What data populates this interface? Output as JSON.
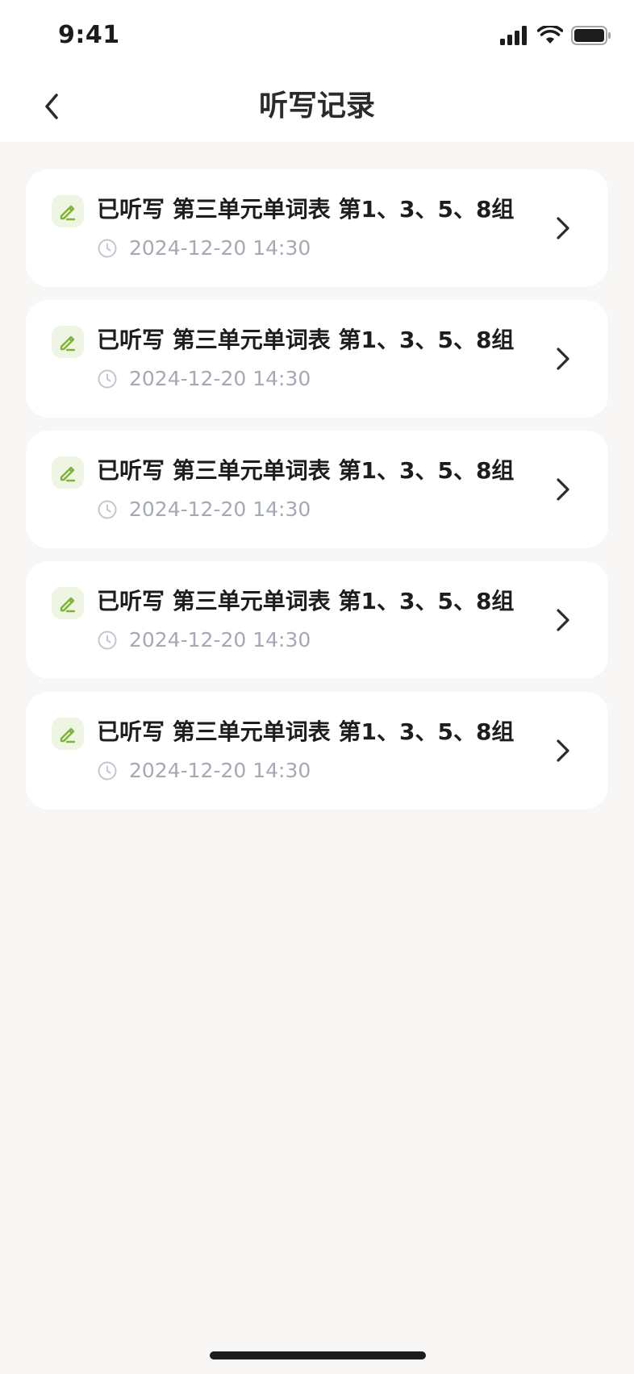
{
  "status_bar": {
    "time": "9:41"
  },
  "nav": {
    "title": "听写记录"
  },
  "records": [
    {
      "title": "已听写 第三单元单词表 第1、3、5、8组",
      "time": "2024-12-20 14:30"
    },
    {
      "title": "已听写 第三单元单词表 第1、3、5、8组",
      "time": "2024-12-20 14:30"
    },
    {
      "title": "已听写 第三单元单词表 第1、3、5、8组",
      "time": "2024-12-20 14:30"
    },
    {
      "title": "已听写 第三单元单词表 第1、3、5、8组",
      "time": "2024-12-20 14:30"
    },
    {
      "title": "已听写 第三单元单词表 第1、3、5、8组",
      "time": "2024-12-20 14:30"
    }
  ],
  "icons": {
    "record": "pencil-icon",
    "time": "clock-icon",
    "open": "chevron-right-icon",
    "back": "chevron-left-icon"
  },
  "colors": {
    "accent": "#7fb23a",
    "icon_bg": "#eef6e3",
    "muted": "#a4a9b3",
    "background": "#f8f7f5"
  }
}
